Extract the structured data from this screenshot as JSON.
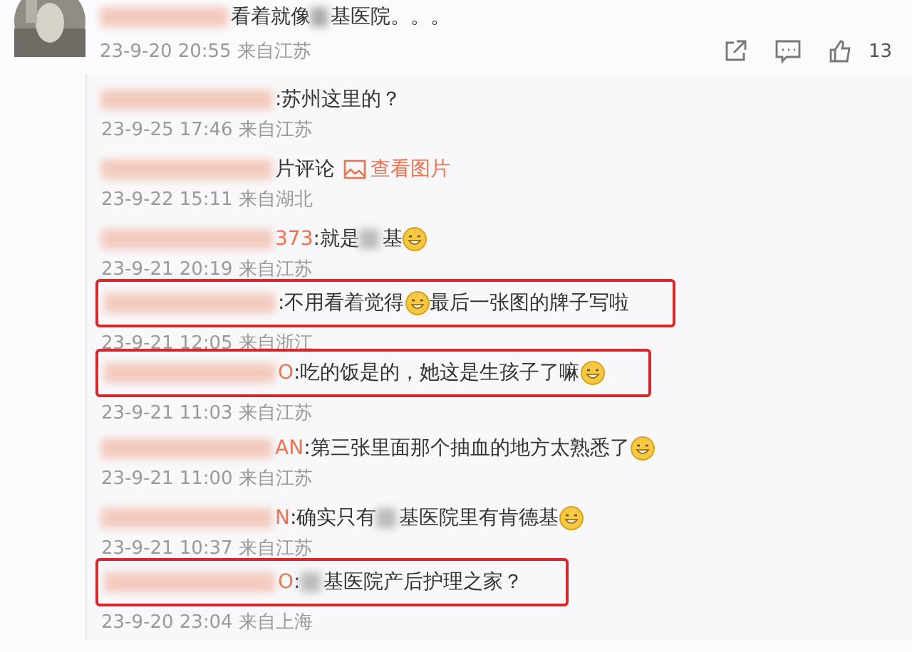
{
  "comment": {
    "parts": [
      {
        "kind": "blur"
      },
      {
        "kind": "text",
        "text": "看着就像"
      },
      {
        "kind": "blur"
      },
      {
        "kind": "text",
        "text": "基医院。。。"
      }
    ],
    "time": "23-9-20 20:55",
    "location": "来自江苏",
    "likes": "13"
  },
  "replies": [
    {
      "highlighted": false,
      "parts": [
        {
          "kind": "blur"
        },
        {
          "kind": "text",
          "text": ":苏州这里的？"
        }
      ],
      "time": "23-9-25 17:46",
      "location": "来自江苏"
    },
    {
      "highlighted": false,
      "parts": [
        {
          "kind": "blur"
        },
        {
          "kind": "text",
          "text": "片评论"
        },
        {
          "kind": "image-link",
          "text": "查看图片"
        }
      ],
      "time": "23-9-22 15:11",
      "location": "来自湖北"
    },
    {
      "highlighted": false,
      "parts": [
        {
          "kind": "blur"
        },
        {
          "kind": "name",
          "text": "373"
        },
        {
          "kind": "text",
          "text": ":就是"
        },
        {
          "kind": "blur"
        },
        {
          "kind": "text",
          "text": "基"
        },
        {
          "kind": "emoji"
        }
      ],
      "time": "23-9-21 20:19",
      "location": "来自江苏"
    },
    {
      "highlighted": true,
      "parts": [
        {
          "kind": "blur"
        },
        {
          "kind": "text",
          "text": ":不用看着觉得"
        },
        {
          "kind": "emoji"
        },
        {
          "kind": "text",
          "text": "最后一张图的牌子写啦"
        }
      ],
      "time": "23-9-21 12:05",
      "location": "来自浙江"
    },
    {
      "highlighted": true,
      "parts": [
        {
          "kind": "blur"
        },
        {
          "kind": "name",
          "text": "O"
        },
        {
          "kind": "text",
          "text": ":吃的饭是的，她这是生孩子了嘛"
        },
        {
          "kind": "emoji"
        }
      ],
      "time": "23-9-21 11:03",
      "location": "来自江苏"
    },
    {
      "highlighted": false,
      "parts": [
        {
          "kind": "blur"
        },
        {
          "kind": "name",
          "text": "AN"
        },
        {
          "kind": "text",
          "text": ":第三张里面那个抽血的地方太熟悉了"
        },
        {
          "kind": "emoji"
        }
      ],
      "time": "23-9-21 11:00",
      "location": "来自江苏"
    },
    {
      "highlighted": false,
      "parts": [
        {
          "kind": "blur"
        },
        {
          "kind": "name",
          "text": "N"
        },
        {
          "kind": "text",
          "text": ":确实只有"
        },
        {
          "kind": "blur"
        },
        {
          "kind": "text",
          "text": "基医院里有肯德基"
        },
        {
          "kind": "emoji"
        }
      ],
      "time": "23-9-21 10:37",
      "location": "来自江苏"
    },
    {
      "highlighted": true,
      "parts": [
        {
          "kind": "blur"
        },
        {
          "kind": "name",
          "text": "O"
        },
        {
          "kind": "text",
          "text": ":"
        },
        {
          "kind": "blur"
        },
        {
          "kind": "text",
          "text": "基医院产后护理之家？"
        }
      ],
      "time": "23-9-20 23:04",
      "location": "来自上海"
    }
  ]
}
